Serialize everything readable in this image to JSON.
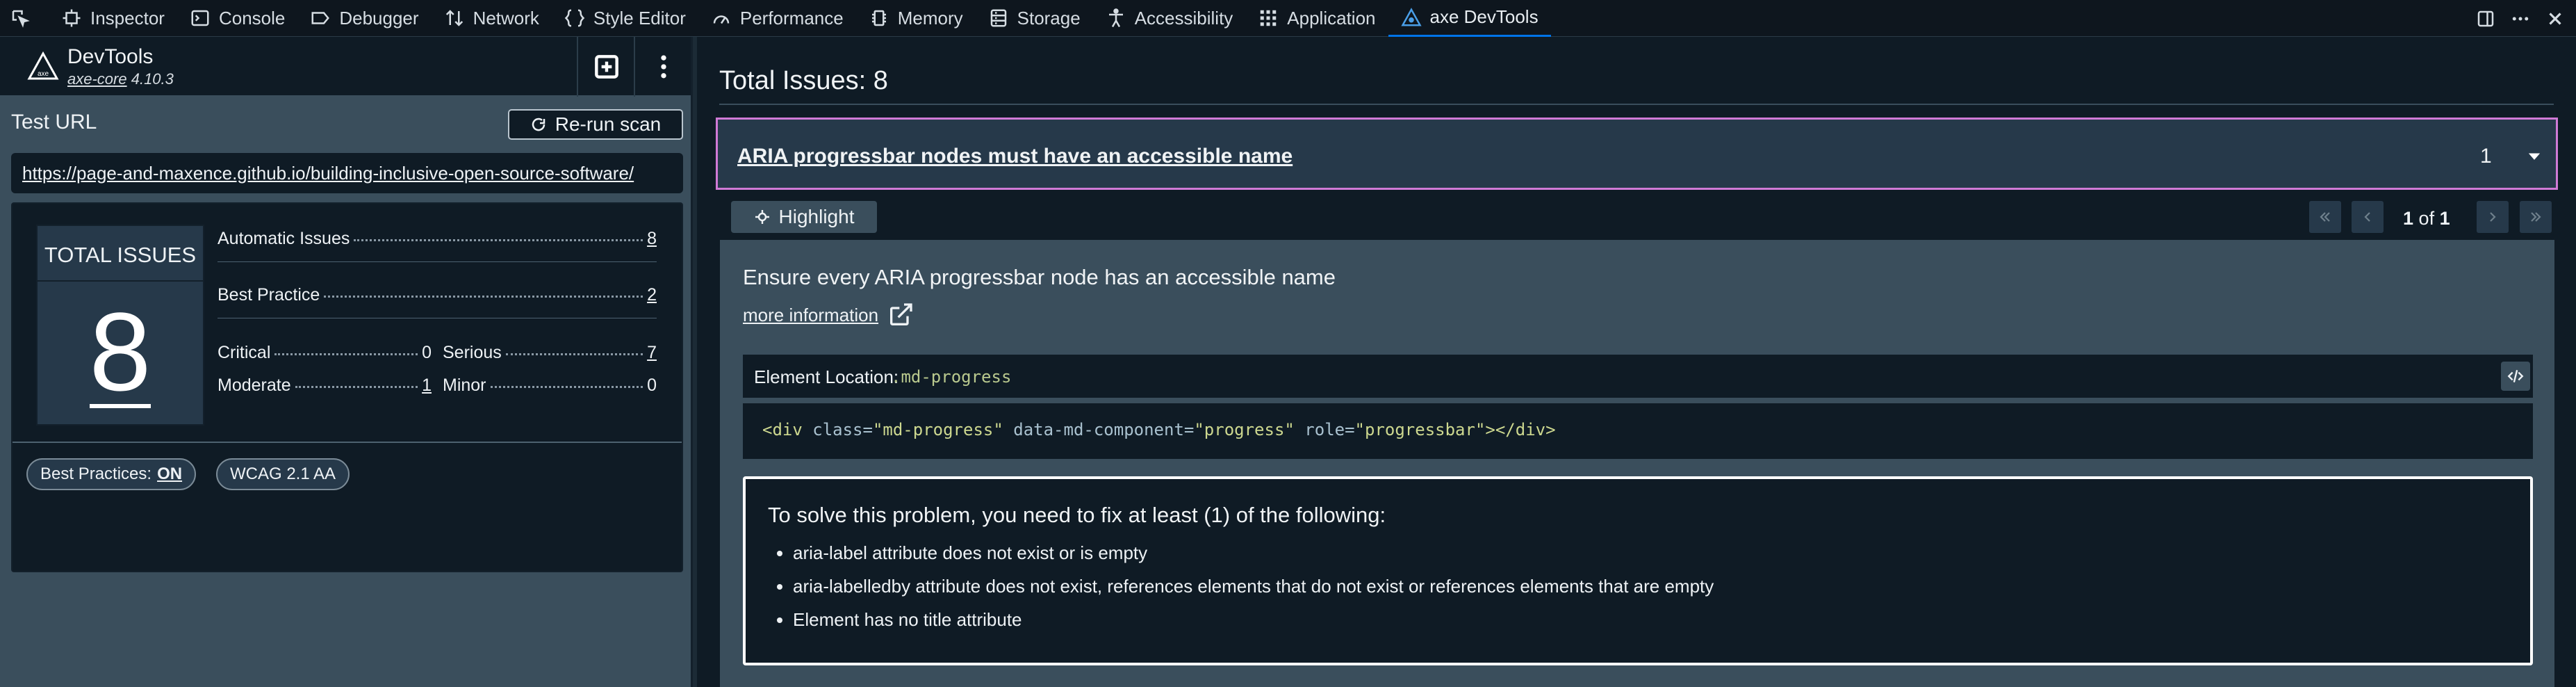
{
  "devtools_tabs": [
    {
      "label": "Inspector",
      "icon": "inspector-icon"
    },
    {
      "label": "Console",
      "icon": "console-icon"
    },
    {
      "label": "Debugger",
      "icon": "debugger-icon"
    },
    {
      "label": "Network",
      "icon": "network-icon"
    },
    {
      "label": "Style Editor",
      "icon": "style-editor-icon"
    },
    {
      "label": "Performance",
      "icon": "performance-icon"
    },
    {
      "label": "Memory",
      "icon": "memory-icon"
    },
    {
      "label": "Storage",
      "icon": "storage-icon"
    },
    {
      "label": "Accessibility",
      "icon": "accessibility-icon"
    },
    {
      "label": "Application",
      "icon": "application-icon"
    },
    {
      "label": "axe DevTools",
      "icon": "axe-icon"
    }
  ],
  "app": {
    "title": "DevTools",
    "core_name": "axe-core",
    "core_version": "4.10.3"
  },
  "test_url": {
    "label": "Test URL",
    "rerun_label": "Re-run scan",
    "url": "https://page-and-maxence.github.io/building-inclusive-open-source-software/"
  },
  "summary": {
    "total_label": "TOTAL ISSUES",
    "total": "8",
    "automatic_label": "Automatic Issues",
    "automatic": "8",
    "best_practice_label": "Best Practice",
    "best_practice": "2",
    "critical_label": "Critical",
    "critical": "0",
    "serious_label": "Serious",
    "serious": "7",
    "moderate_label": "Moderate",
    "moderate": "1",
    "minor_label": "Minor",
    "minor": "0",
    "best_practices_pill": "Best Practices:",
    "best_practices_state": "ON",
    "standard_pill": "WCAG 2.1 AA"
  },
  "issues_panel": {
    "title": "Total Issues: 8",
    "issue_title": "ARIA progressbar nodes must have an accessible name",
    "issue_count": "1",
    "highlight_label": "Highlight",
    "page_current": "1",
    "page_of": "of",
    "page_total": "1",
    "description": "Ensure every ARIA progressbar node has an accessible name",
    "more_info": "more information",
    "element_location_label": "Element Location:",
    "element_selector": ".md-progress",
    "code": {
      "open": "<div",
      "attr1": "class",
      "val1": "\"md-progress\"",
      "attr2": "data-md-component",
      "val2": "\"progress\"",
      "attr3": "role",
      "val3": "\"progressbar\"",
      "close": "></div>"
    },
    "fix_heading": "To solve this problem, you need to fix at least (1) of the following:",
    "fix_items": [
      "aria-label attribute does not exist or is empty",
      "aria-labelledby attribute does not exist, references elements that do not exist or references elements that are empty",
      "Element has no title attribute"
    ]
  },
  "colors": {
    "accent_border": "#d07ad6",
    "panel_dark": "#0f1b25",
    "panel_mid": "#3a4e5c",
    "selector_green": "#b9c98e"
  }
}
